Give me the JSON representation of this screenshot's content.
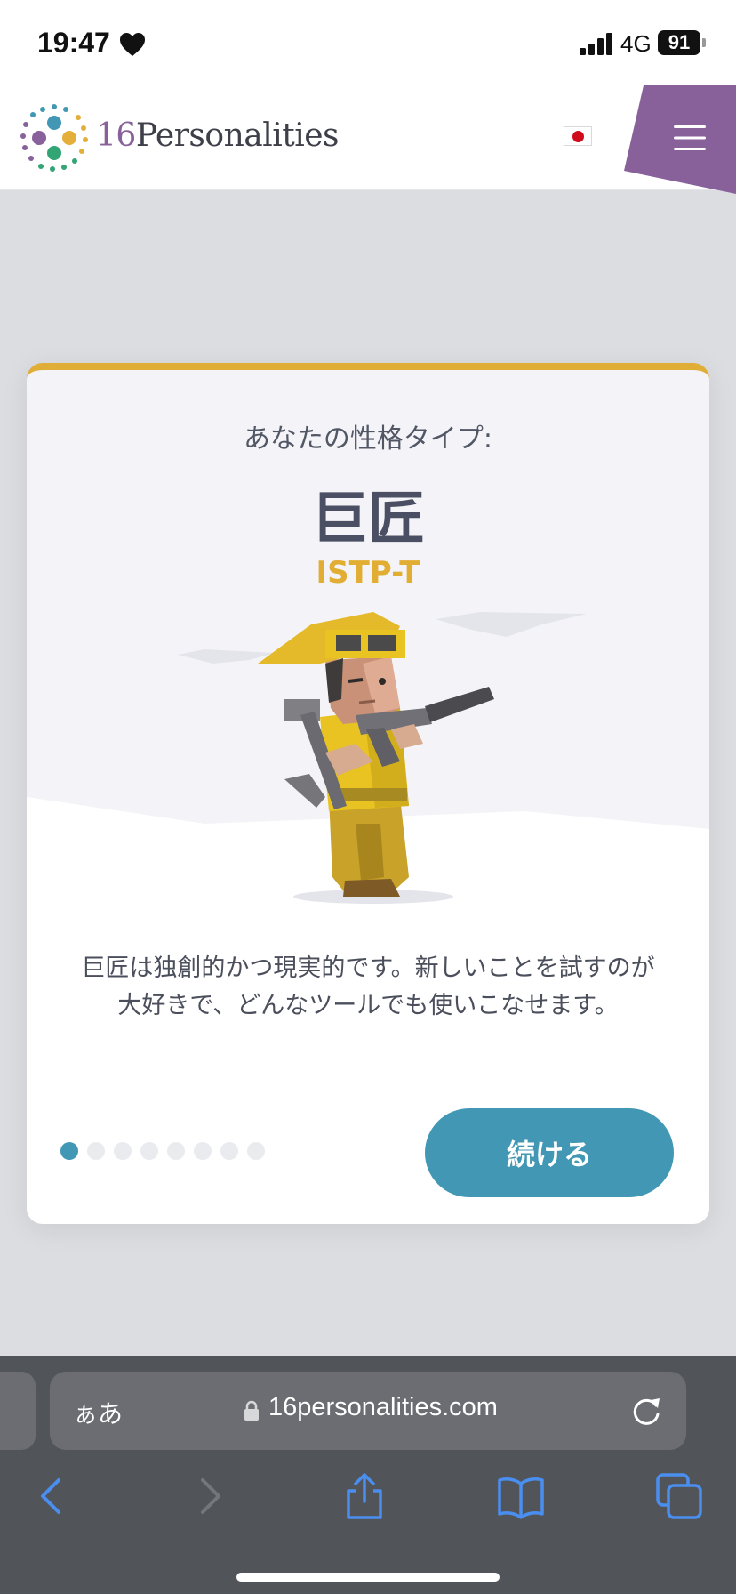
{
  "status_bar": {
    "time": "19:47",
    "network": "4G",
    "battery": "91"
  },
  "header": {
    "logo_number": "16",
    "logo_word": "Personalities",
    "accent_purple": "#88619a"
  },
  "card": {
    "label": "あなたの性格タイプ:",
    "type_name": "巨匠",
    "type_code": "ISTP-T",
    "description_line1": "巨匠は独創的かつ現実的です。新しいことを試すのが",
    "description_line2": "大好きで、どんなツールでも使いこなせます。",
    "continue_label": "続ける",
    "pager_total": 8,
    "pager_current": 1,
    "accent_color": "#e0ad36",
    "button_color": "#4298b4"
  },
  "browser": {
    "aa_label": "ぁあ",
    "url": "16personalities.com"
  }
}
